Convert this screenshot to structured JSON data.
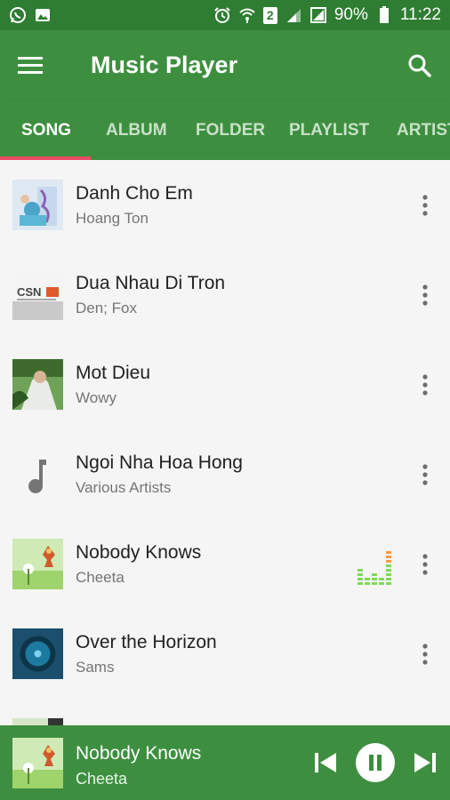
{
  "status_bar": {
    "battery_percent": "90%",
    "time": "11:22",
    "sim_badge": "2",
    "icons": [
      "whatsapp-icon",
      "gallery-notification-icon",
      "alarm-icon",
      "wifi-icon",
      "sim-2-icon",
      "signal-icon",
      "signal-icon",
      "battery-icon"
    ]
  },
  "app_bar": {
    "title": "Music Player",
    "menu_icon": "hamburger-menu-icon",
    "search_icon": "search-icon"
  },
  "tabs": [
    {
      "label": "SONG",
      "active": true
    },
    {
      "label": "ALBUM",
      "active": false
    },
    {
      "label": "FOLDER",
      "active": false
    },
    {
      "label": "PLAYLIST",
      "active": false
    },
    {
      "label": "ARTIST",
      "active": false
    }
  ],
  "songs": [
    {
      "title": "Danh Cho Em",
      "artist": "Hoang Ton",
      "art": "album-art"
    },
    {
      "title": "Dua Nhau Di Tron",
      "artist": "Den; Fox",
      "art": "album-art"
    },
    {
      "title": "Mot Dieu",
      "artist": "Wowy",
      "art": "album-art"
    },
    {
      "title": "Ngoi Nha Hoa Hong",
      "artist": "Various Artists",
      "art": "music-note-icon"
    },
    {
      "title": "Nobody Knows",
      "artist": "Cheeta",
      "art": "album-art",
      "playing": true
    },
    {
      "title": "Over the Horizon",
      "artist": "Sams",
      "art": "album-art"
    }
  ],
  "art_label": "CSN",
  "now_playing": {
    "title": "Nobody Knows",
    "artist": "Cheeta",
    "controls": [
      "previous-icon",
      "pause-icon",
      "next-icon"
    ]
  },
  "colors": {
    "primary": "#3d8f3f",
    "primary_dark": "#2e7d32",
    "accent": "#ef4c63",
    "eq_green": "#7ed957",
    "eq_orange": "#ff9a3c"
  }
}
